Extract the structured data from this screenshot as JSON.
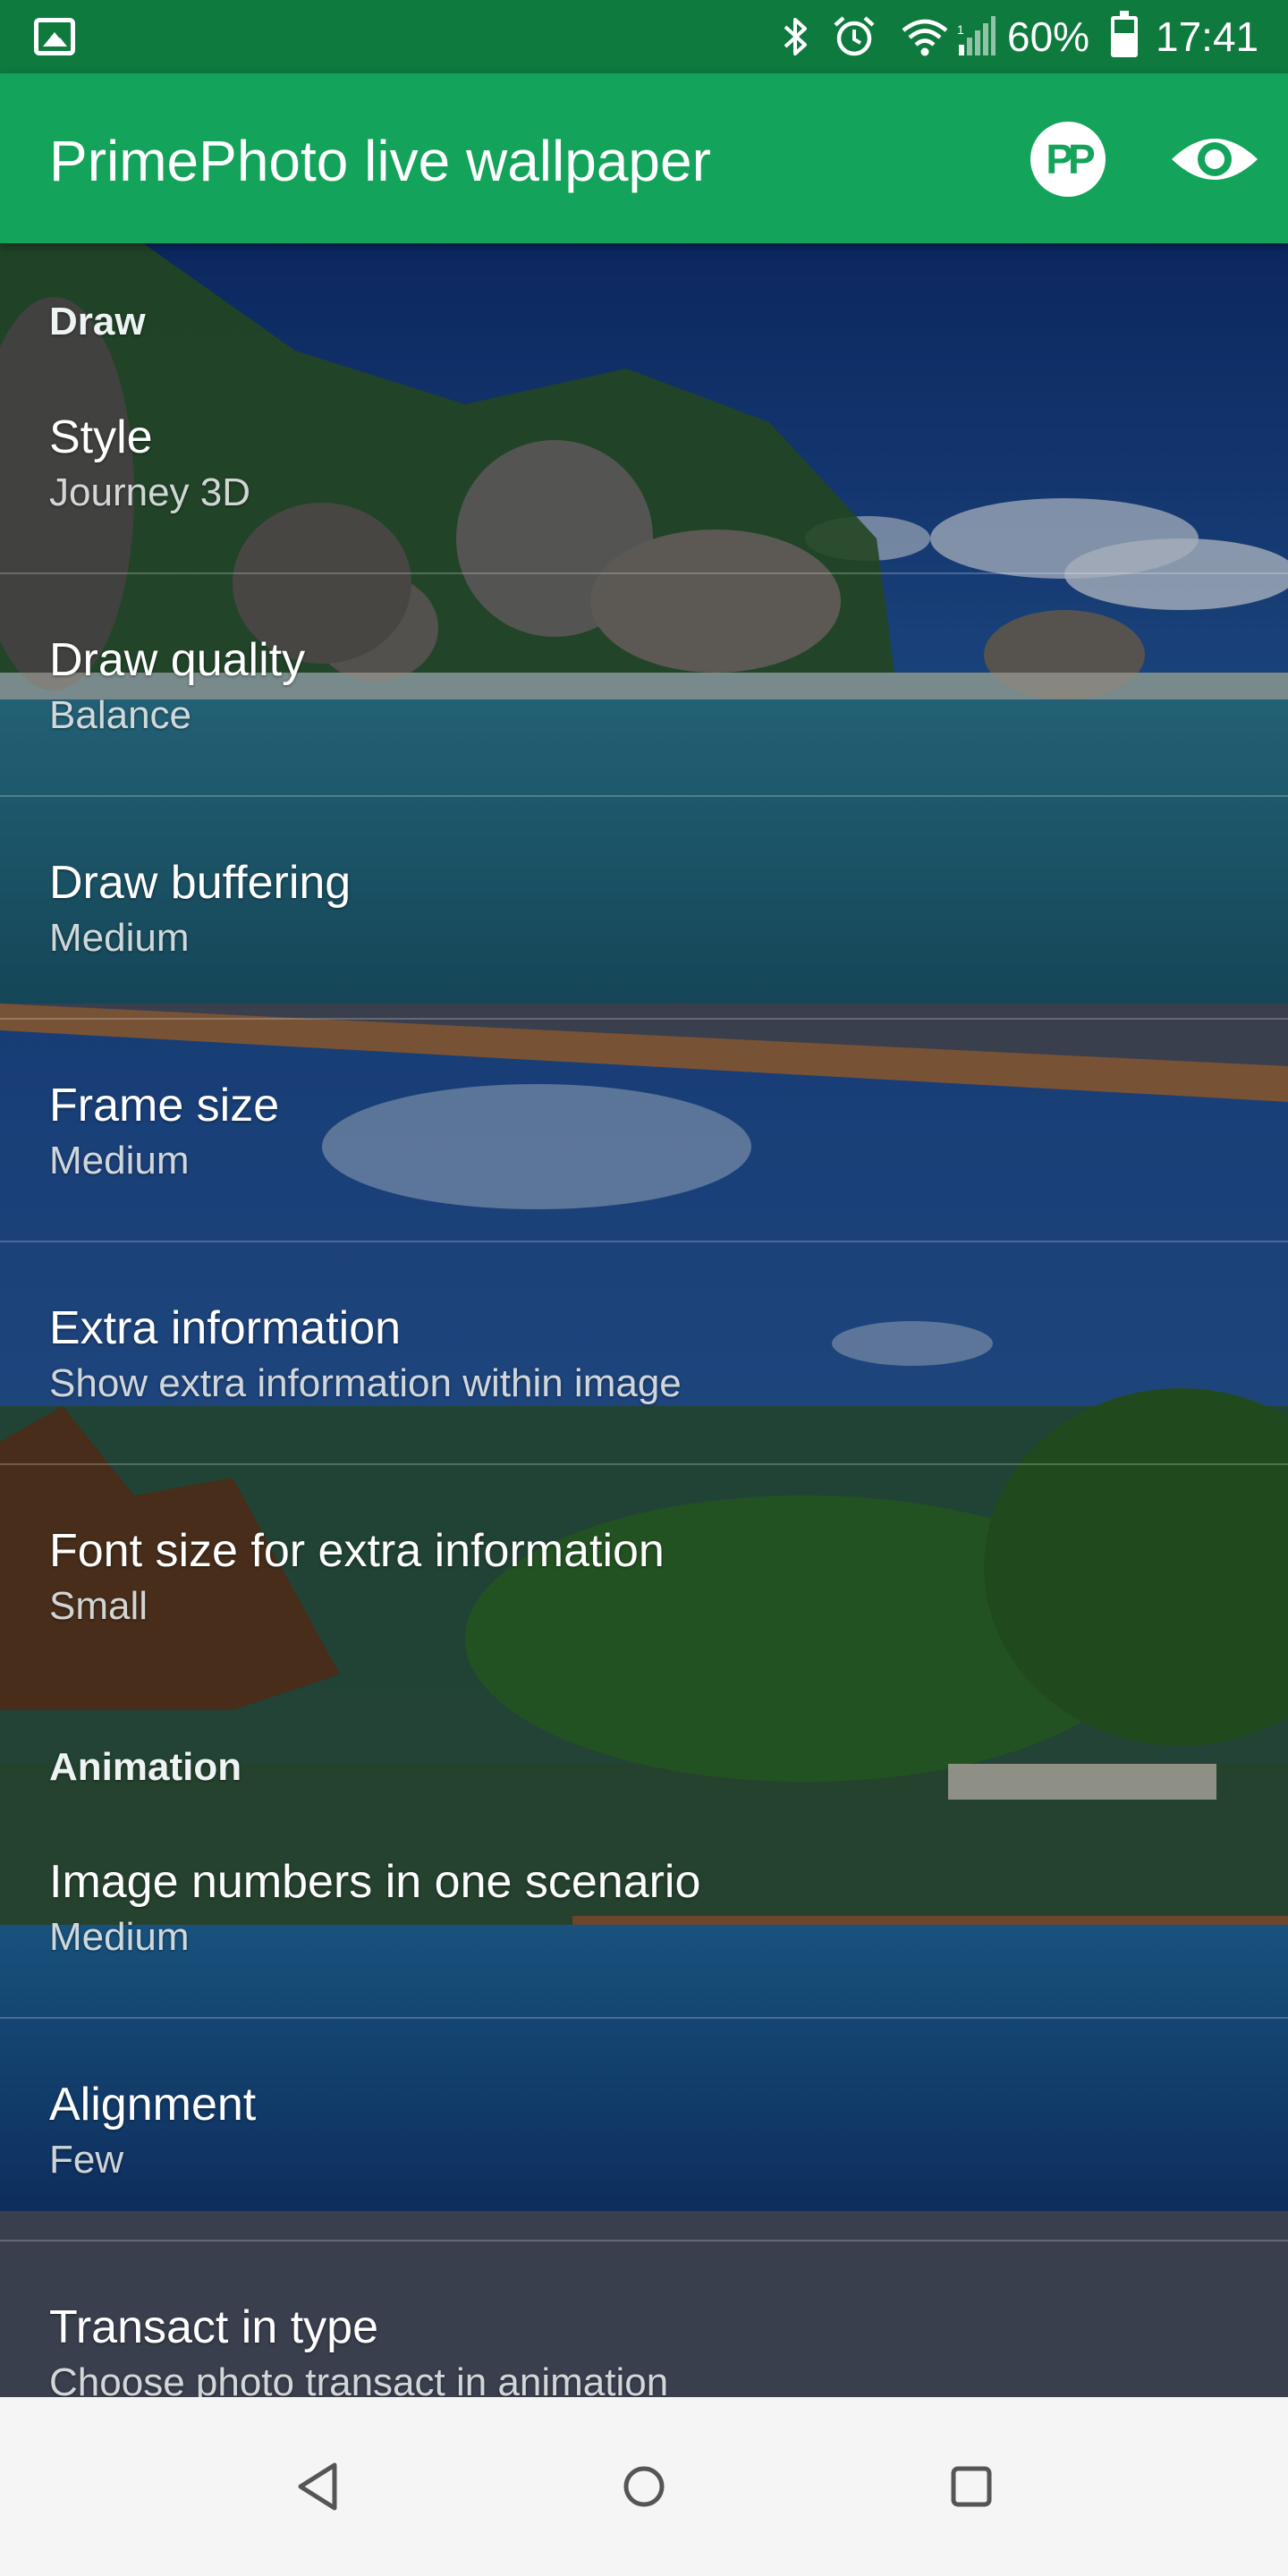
{
  "status_bar": {
    "notification_icon": "gallery-icon",
    "icons": [
      "bluetooth-icon",
      "alarm-icon",
      "wifi-icon",
      "signal-icon"
    ],
    "battery_percent": "60%",
    "battery_level": 0.6,
    "time": "17:41"
  },
  "app_bar": {
    "title": "PrimePhoto live wallpaper",
    "actions": [
      {
        "name": "primephoto-icon",
        "label": "PP"
      },
      {
        "name": "eye-icon",
        "label": ""
      }
    ],
    "color": "#13a35a",
    "status_color": "#0e7a3e"
  },
  "sections": [
    {
      "category": "Draw",
      "items": [
        {
          "title": "Style",
          "summary": "Journey 3D"
        },
        {
          "title": "Draw quality",
          "summary": "Balance"
        },
        {
          "title": "Draw buffering",
          "summary": "Medium"
        },
        {
          "title": "Frame size",
          "summary": "Medium"
        },
        {
          "title": "Extra information",
          "summary": "Show extra information within image"
        },
        {
          "title": "Font size for extra information",
          "summary": "Small"
        }
      ]
    },
    {
      "category": "Animation",
      "items": [
        {
          "title": "Image numbers in one scenario",
          "summary": "Medium"
        },
        {
          "title": "Alignment",
          "summary": "Few"
        },
        {
          "title": "Transact in type",
          "summary": "Choose photo transact in animation"
        }
      ]
    }
  ],
  "nav_bar": {
    "buttons": [
      "back-icon",
      "home-icon",
      "recents-icon"
    ]
  }
}
